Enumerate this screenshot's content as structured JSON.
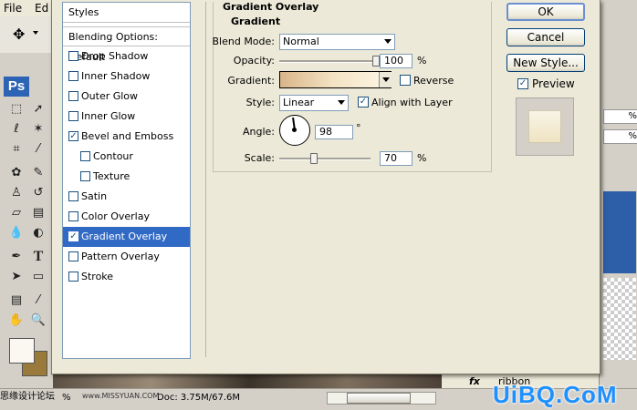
{
  "app": {
    "menu": [
      "File",
      "Ed"
    ],
    "logo": "Ps",
    "fg_color": "#faf8f0",
    "bg_color": "#9a7a3a",
    "status": {
      "zoom": "%",
      "doc": "Doc: 3.75M/67.6M",
      "layer_name": "ribbon",
      "fx": "fx",
      "watermark": "思缘设计论坛",
      "watermark_url": "www.MISSYUAN.COM",
      "site": "UiBQ.CoM"
    }
  },
  "dialog": {
    "styles_header": "Styles",
    "blending_default": "Blending Options: Default",
    "styles": [
      {
        "label": "Drop Shadow",
        "checked": false,
        "indent": false
      },
      {
        "label": "Inner Shadow",
        "checked": false,
        "indent": false
      },
      {
        "label": "Outer Glow",
        "checked": false,
        "indent": false
      },
      {
        "label": "Inner Glow",
        "checked": false,
        "indent": false
      },
      {
        "label": "Bevel and Emboss",
        "checked": true,
        "indent": false
      },
      {
        "label": "Contour",
        "checked": false,
        "indent": true
      },
      {
        "label": "Texture",
        "checked": false,
        "indent": true
      },
      {
        "label": "Satin",
        "checked": false,
        "indent": false
      },
      {
        "label": "Color Overlay",
        "checked": false,
        "indent": false
      },
      {
        "label": "Gradient Overlay",
        "checked": true,
        "indent": false,
        "selected": true
      },
      {
        "label": "Pattern Overlay",
        "checked": false,
        "indent": false
      },
      {
        "label": "Stroke",
        "checked": false,
        "indent": false
      }
    ],
    "section_title": "Gradient Overlay",
    "group_title": "Gradient",
    "blend_mode_label": "Blend Mode:",
    "blend_mode_value": "Normal",
    "opacity_label": "Opacity:",
    "opacity_value": "100",
    "opacity_unit": "%",
    "opacity_fraction": 1.0,
    "gradient_label": "Gradient:",
    "reverse_label": "Reverse",
    "reverse_checked": false,
    "style_label": "Style:",
    "style_value": "Linear",
    "align_label": "Align with Layer",
    "align_checked": true,
    "angle_label": "Angle:",
    "angle_value": "98",
    "angle_unit": "°",
    "scale_label": "Scale:",
    "scale_value": "70",
    "scale_unit": "%",
    "scale_fraction": 0.38,
    "gradient_colors": [
      "#d9b589",
      "#f4e4c6",
      "#fdf6e6"
    ],
    "buttons": {
      "ok": "OK",
      "cancel": "Cancel",
      "new_style": "New Style..."
    },
    "preview_label": "Preview",
    "preview_checked": true
  }
}
